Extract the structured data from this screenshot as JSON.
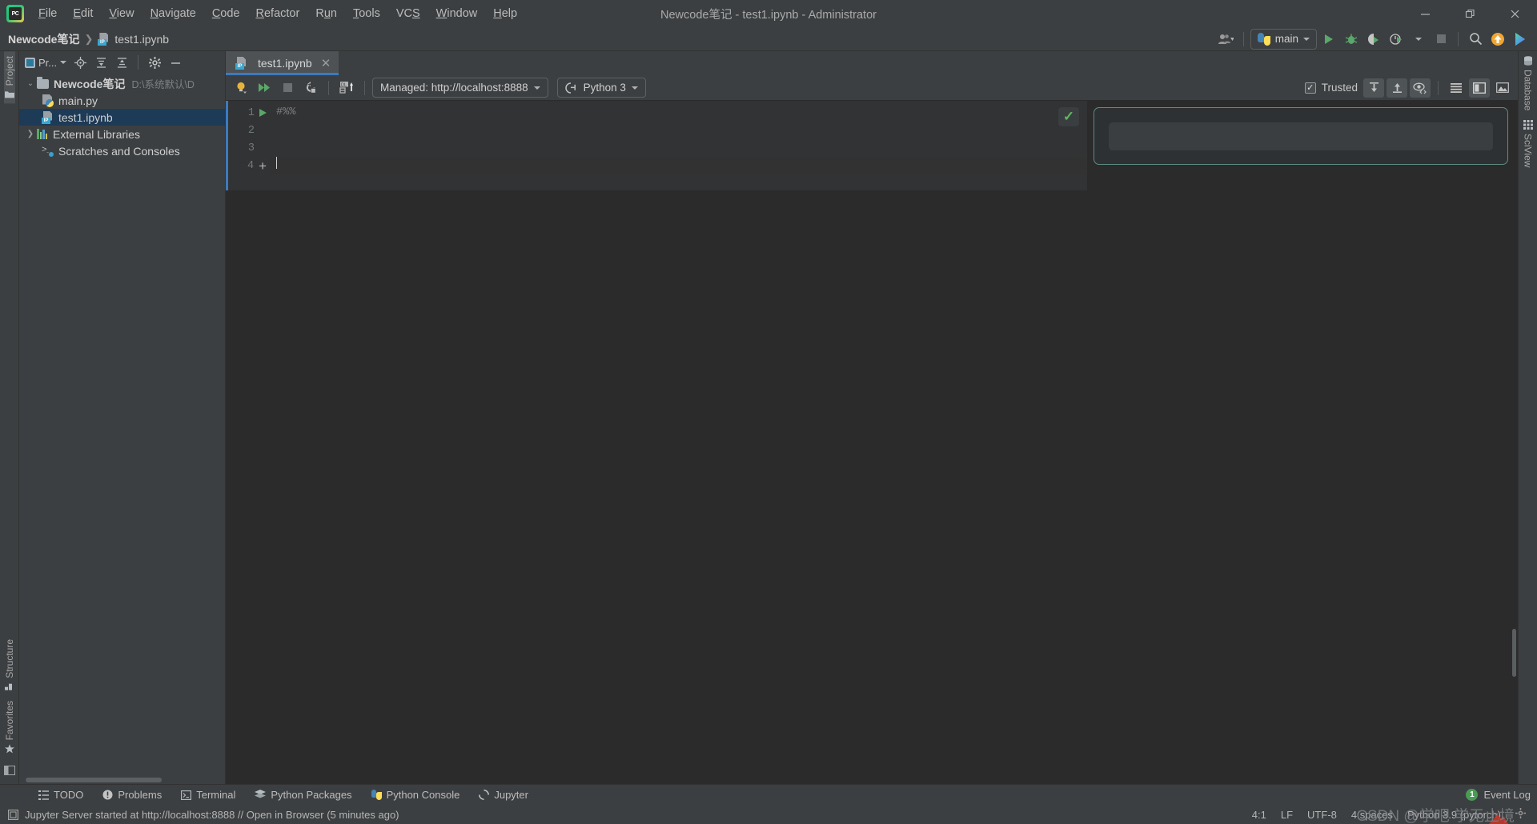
{
  "window": {
    "title": "Newcode笔记 - test1.ipynb - Administrator",
    "minimize_label": "—",
    "restore_label": "❐",
    "close_label": "✕"
  },
  "menu": {
    "items": [
      {
        "label": "File"
      },
      {
        "label": "Edit"
      },
      {
        "label": "View"
      },
      {
        "label": "Navigate"
      },
      {
        "label": "Code"
      },
      {
        "label": "Refactor"
      },
      {
        "label": "Run"
      },
      {
        "label": "Tools"
      },
      {
        "label": "VCS"
      },
      {
        "label": "Window"
      },
      {
        "label": "Help"
      }
    ]
  },
  "navbar": {
    "project_crumb": "Newcode笔记",
    "separator": "❯",
    "file_crumb": "test1.ipynb",
    "file_icon_tag": "IP",
    "run_config": "main",
    "icons": {
      "user": "user-settings-icon",
      "run": "run-icon",
      "debug": "debug-icon",
      "coverage": "coverage-icon",
      "profile": "profile-icon",
      "stop": "stop-icon",
      "search": "search-icon",
      "update": "update-icon",
      "ai": "ai-assistant-icon"
    }
  },
  "left_stripe": {
    "items": [
      {
        "label": "Project",
        "active": true
      },
      {
        "label": "Structure",
        "active": false
      },
      {
        "label": "Favorites",
        "active": false
      }
    ]
  },
  "right_stripe": {
    "items": [
      {
        "label": "Database"
      },
      {
        "label": "SciView"
      }
    ]
  },
  "project_panel": {
    "title": "Pr...",
    "toolbar_icons": [
      "locate-icon",
      "expand-all-icon",
      "collapse-all-icon",
      "settings-gear-icon",
      "hide-icon"
    ],
    "tree": [
      {
        "label": "Newcode笔记",
        "path": "D:\\系统默认\\D",
        "icon": "folder-icon",
        "arrow": "⌄",
        "depth": 0,
        "bold": true,
        "selected": false
      },
      {
        "label": "main.py",
        "path": "",
        "icon": "python-file-icon",
        "arrow": "",
        "depth": 1,
        "bold": false,
        "selected": false
      },
      {
        "label": "test1.ipynb",
        "path": "",
        "icon": "ipynb-file-icon",
        "arrow": "",
        "depth": 1,
        "bold": false,
        "selected": true
      },
      {
        "label": "External Libraries",
        "path": "",
        "icon": "libraries-icon",
        "arrow": "❯",
        "depth": 0,
        "bold": false,
        "selected": false
      },
      {
        "label": "Scratches and Consoles",
        "path": "",
        "icon": "scratches-icon",
        "arrow": "",
        "depth": 1,
        "bold": false,
        "selected": false
      }
    ]
  },
  "editor": {
    "tab": {
      "label": "test1.ipynb",
      "close": "✕",
      "icon_tag": "IP"
    },
    "jupyter_toolbar": {
      "server": "Managed: http://localhost:8888",
      "kernel": "Python 3",
      "trusted_label": "Trusted",
      "trusted_checked": "✓",
      "icons": {
        "hints": "lightbulb-icon",
        "run_all": "run-all-cells-icon",
        "interrupt": "stop-kernel-icon",
        "restart": "restart-kernel-icon",
        "upload": "upload-notebook-icon",
        "server_dropdown": "chevron-down-icon",
        "kernel_icon": "kernel-icon",
        "move_down": "move-cell-down-icon",
        "move_up": "move-cell-up-icon",
        "preview": "preview-code-icon",
        "list_view": "list-view-icon",
        "split_view": "split-view-icon",
        "image_view": "image-view-icon"
      }
    },
    "cell": {
      "lines": [
        {
          "number": "1",
          "text": "#%%",
          "has_run": true
        },
        {
          "number": "2",
          "text": "",
          "has_run": false
        },
        {
          "number": "3",
          "text": "",
          "has_run": false
        },
        {
          "number": "4",
          "text": "",
          "has_run": false,
          "has_plus": true,
          "active": true
        }
      ],
      "status_icon": "✓"
    },
    "output": {
      "placeholder": ""
    }
  },
  "bottom_bar": {
    "items": [
      {
        "label": "TODO",
        "icon": "todo-icon"
      },
      {
        "label": "Problems",
        "icon": "problems-icon"
      },
      {
        "label": "Terminal",
        "icon": "terminal-icon"
      },
      {
        "label": "Python Packages",
        "icon": "packages-icon"
      },
      {
        "label": "Python Console",
        "icon": "python-console-icon"
      },
      {
        "label": "Jupyter",
        "icon": "jupyter-icon"
      }
    ],
    "event_log": {
      "label": "Event Log",
      "count": "1"
    }
  },
  "status_bar": {
    "message": "Jupyter Server started at http://localhost:8888 // Open in Browser (5 minutes ago)",
    "caret": "4:1",
    "line_sep": "LF",
    "encoding": "UTF-8",
    "indent": "4 spaces",
    "interpreter": "Python 3.9 (pytorch)",
    "watermark": "CSDN @学吧 学无止境"
  },
  "colors": {
    "accent_blue": "#3c7bbf",
    "run_green": "#59a869",
    "output_border": "#5e8b80",
    "selection_blue": "#1d3a56"
  }
}
